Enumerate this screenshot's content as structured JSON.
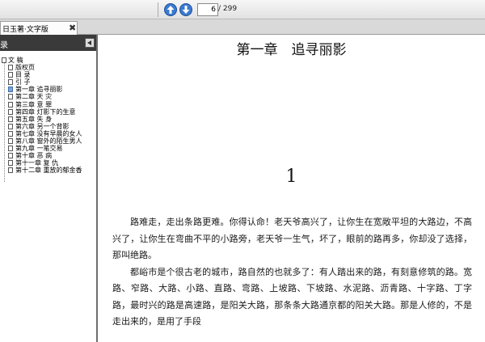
{
  "toolbar": {
    "page_current": "6",
    "page_total": "/ 299",
    "prev_icon": "arrow-up-icon",
    "next_icon": "arrow-down-icon",
    "accent": "#3b7bd0"
  },
  "tab": {
    "title": "日玉著·文字版",
    "close": "✖"
  },
  "sidebar": {
    "title": "录",
    "root": "文 稿",
    "items": [
      {
        "label": "版权页"
      },
      {
        "label": "目 录"
      },
      {
        "label": "引 子"
      },
      {
        "label": "第一章 追寻丽影",
        "active": true
      },
      {
        "label": "第二章 天 灾"
      },
      {
        "label": "第三章 意 罪"
      },
      {
        "label": "第四章 灯影下的生意"
      },
      {
        "label": "第五章 失 身"
      },
      {
        "label": "第六章 另一个背影"
      },
      {
        "label": "第七章 没有早晨的女人"
      },
      {
        "label": "第八章 窗外的陌生男人"
      },
      {
        "label": "第九章 一笔交易"
      },
      {
        "label": "第十章 恶 病"
      },
      {
        "label": "第十一章 复 仇"
      },
      {
        "label": "第十二章 重放的郁金香"
      }
    ]
  },
  "document": {
    "chapter_title": "第一章　追寻丽影",
    "chapter_number": "1",
    "paragraphs": [
      "路难走，走出条路更难。你得认命！老天爷高兴了，让你生在宽敞平坦的大路边，不高兴了，让你生在弯曲不平的小路旁，老天爷一生气，坏了，眼前的路再多，你却没了选择，那叫绝路。",
      "都峪市是个很古老的城市，路自然的也就多了：有人踏出来的路，有刻意修筑的路。宽路、窄路、大路、小路、直路、弯路、上坡路、下坡路、水泥路、沥青路、十字路、丁字路，最时兴的路是高速路，是阳关大路，那条条大路通京都的阳关大路。那是人修的，不是走出来的，是用了手段"
    ]
  }
}
